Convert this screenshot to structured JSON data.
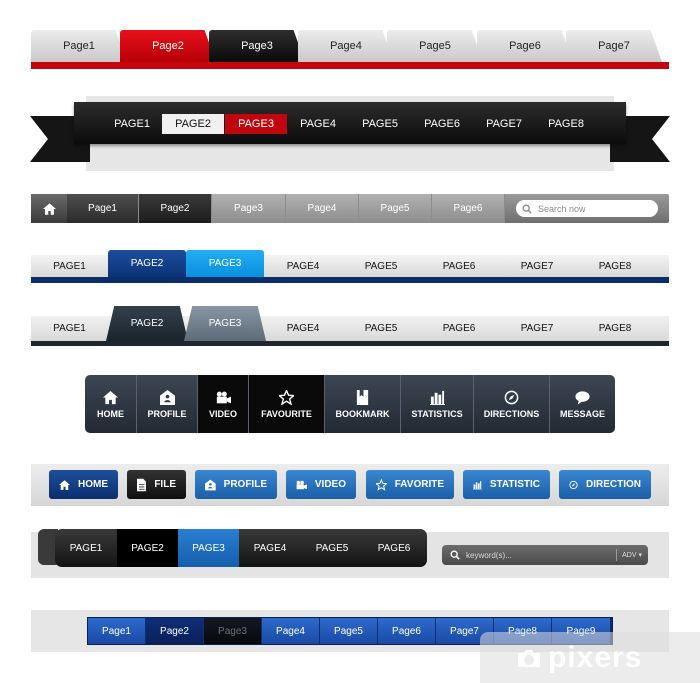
{
  "row1": {
    "tabs": [
      "Page1",
      "Page2",
      "Page3",
      "Page4",
      "Page5",
      "Page6",
      "Page7"
    ],
    "active_red": "Page2",
    "active_black": "Page3",
    "accent": "#c3040b"
  },
  "row2": {
    "items": [
      "PAGE1",
      "PAGE2",
      "PAGE3",
      "PAGE4",
      "PAGE5",
      "PAGE6",
      "PAGE7",
      "PAGE8"
    ],
    "highlight_white": "PAGE2",
    "highlight_red": "PAGE3"
  },
  "row3": {
    "home_icon": "home-icon",
    "items": [
      "Page1",
      "Page2",
      "Page3",
      "Page4",
      "Page5",
      "Page6"
    ],
    "search_placeholder": "Search now",
    "search_icon": "search-icon"
  },
  "row4": {
    "items": [
      "PAGE1",
      "PAGE2",
      "PAGE3",
      "PAGE4",
      "PAGE5",
      "PAGE6",
      "PAGE7",
      "PAGE8"
    ],
    "accent": "#0b2e6b",
    "highlight": "#21adf4"
  },
  "row5": {
    "items": [
      "PAGE1",
      "PAGE2",
      "PAGE3",
      "PAGE4",
      "PAGE5",
      "PAGE6",
      "PAGE7",
      "PAGE8"
    ]
  },
  "row6": {
    "buttons": [
      {
        "label": "HOME",
        "icon": "home-icon"
      },
      {
        "label": "PROFILE",
        "icon": "profile-icon"
      },
      {
        "label": "VIDEO",
        "icon": "video-icon"
      },
      {
        "label": "FAVOURITE",
        "icon": "star-icon"
      },
      {
        "label": "BOOKMARK",
        "icon": "bookmark-icon"
      },
      {
        "label": "STATISTICS",
        "icon": "statistics-icon"
      },
      {
        "label": "DIRECTIONS",
        "icon": "compass-icon"
      },
      {
        "label": "MESSAGE",
        "icon": "message-icon"
      }
    ]
  },
  "row7": {
    "buttons": [
      {
        "label": "HOME",
        "icon": "home-icon"
      },
      {
        "label": "FILE",
        "icon": "file-icon"
      },
      {
        "label": "PROFILE",
        "icon": "profile-icon"
      },
      {
        "label": "VIDEO",
        "icon": "video-icon"
      },
      {
        "label": "FAVORITE",
        "icon": "star-icon"
      },
      {
        "label": "STATISTIC",
        "icon": "statistics-icon"
      },
      {
        "label": "DIRECTION",
        "icon": "compass-icon"
      }
    ]
  },
  "row8": {
    "items": [
      "PAGE1",
      "PAGE2",
      "PAGE3",
      "PAGE4",
      "PAGE5",
      "PAGE6"
    ],
    "search_placeholder": "keyword(s)...",
    "adv_label": "ADV ▾"
  },
  "row9": {
    "items": [
      "Page1",
      "Page2",
      "Page3",
      "Page4",
      "Page5",
      "Page6",
      "Page7",
      "Page8",
      "Page9"
    ]
  },
  "watermark": {
    "text": "pixers"
  }
}
